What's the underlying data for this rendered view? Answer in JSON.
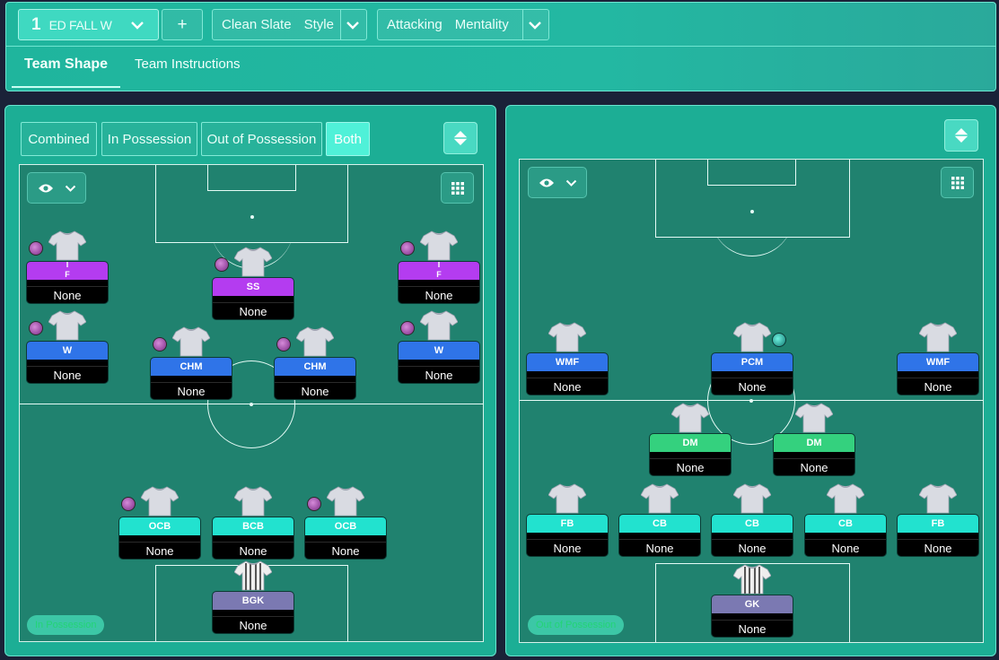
{
  "header": {
    "tactic_number": "1",
    "tactic_name": "ED FALL W",
    "plus": "+",
    "style_value": "Clean Slate",
    "style_label": "Style",
    "mentality_value": "Attacking",
    "mentality_label": "Mentality",
    "tabs": [
      "Team Shape",
      "Team Instructions"
    ]
  },
  "left_panel": {
    "toggles": [
      "Combined",
      "In Possession",
      "Out of Possession",
      "Both"
    ],
    "active_toggle": "Both",
    "phase_label": "In Possession",
    "players": [
      {
        "role": "F",
        "top_label": "I",
        "duty": "None"
      },
      {
        "role": "SS",
        "duty": "None"
      },
      {
        "role": "F",
        "top_label": "I",
        "duty": "None"
      },
      {
        "role": "W",
        "duty": "None"
      },
      {
        "role": "CHM",
        "duty": "None"
      },
      {
        "role": "CHM",
        "duty": "None"
      },
      {
        "role": "W",
        "duty": "None"
      },
      {
        "role": "OCB",
        "duty": "None"
      },
      {
        "role": "BCB",
        "duty": "None"
      },
      {
        "role": "OCB",
        "duty": "None"
      },
      {
        "role": "BGK",
        "duty": "None"
      }
    ]
  },
  "right_panel": {
    "phase_label": "Out of Possession",
    "players": [
      {
        "role": "WMF",
        "duty": "None"
      },
      {
        "role": "PCM",
        "duty": "None"
      },
      {
        "role": "WMF",
        "duty": "None"
      },
      {
        "role": "DM",
        "duty": "None"
      },
      {
        "role": "DM",
        "duty": "None"
      },
      {
        "role": "FB",
        "duty": "None"
      },
      {
        "role": "CB",
        "duty": "None"
      },
      {
        "role": "CB",
        "duty": "None"
      },
      {
        "role": "CB",
        "duty": "None"
      },
      {
        "role": "FB",
        "duty": "None"
      },
      {
        "role": "GK",
        "duty": "None"
      }
    ]
  },
  "colors": {
    "attack": "#b43cf0",
    "midfield": "#2f74e8",
    "defence": "#22e2cf",
    "defensive_mid": "#34d17e",
    "goalkeeper": "#7b79b2",
    "pitch": "#20826f",
    "panel": "#1cae95"
  },
  "icons": [
    "chevron-down-icon",
    "plus-icon",
    "eye-icon",
    "grid-icon",
    "pitch-view-icon",
    "shirt-icon",
    "instruction-badge-icon"
  ]
}
